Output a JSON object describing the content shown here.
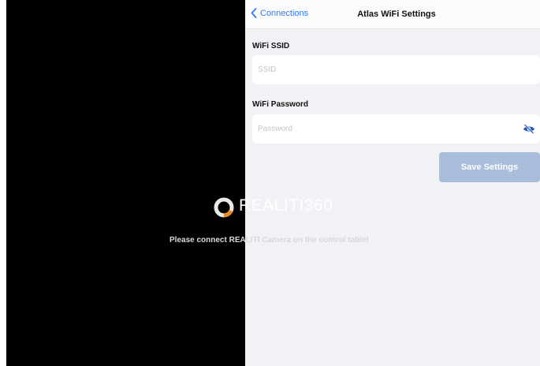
{
  "navbar": {
    "back_label": "Connections",
    "title": "Atlas WiFi Settings"
  },
  "form": {
    "ssid_label": "WiFi SSID",
    "ssid_value": "",
    "ssid_placeholder": "SSID",
    "password_label": "WiFi Password",
    "password_value": "",
    "password_placeholder": "Password",
    "save_label": "Save Settings"
  },
  "background": {
    "logo_text": "REALITI360",
    "message": "Please connect REALITI Camera on the control tablet"
  },
  "colors": {
    "accent": "#2f7cf6",
    "button_disabled": "#a9bedb",
    "panel_bg": "#f2f2f6",
    "logo_orange": "#e98c1e"
  }
}
